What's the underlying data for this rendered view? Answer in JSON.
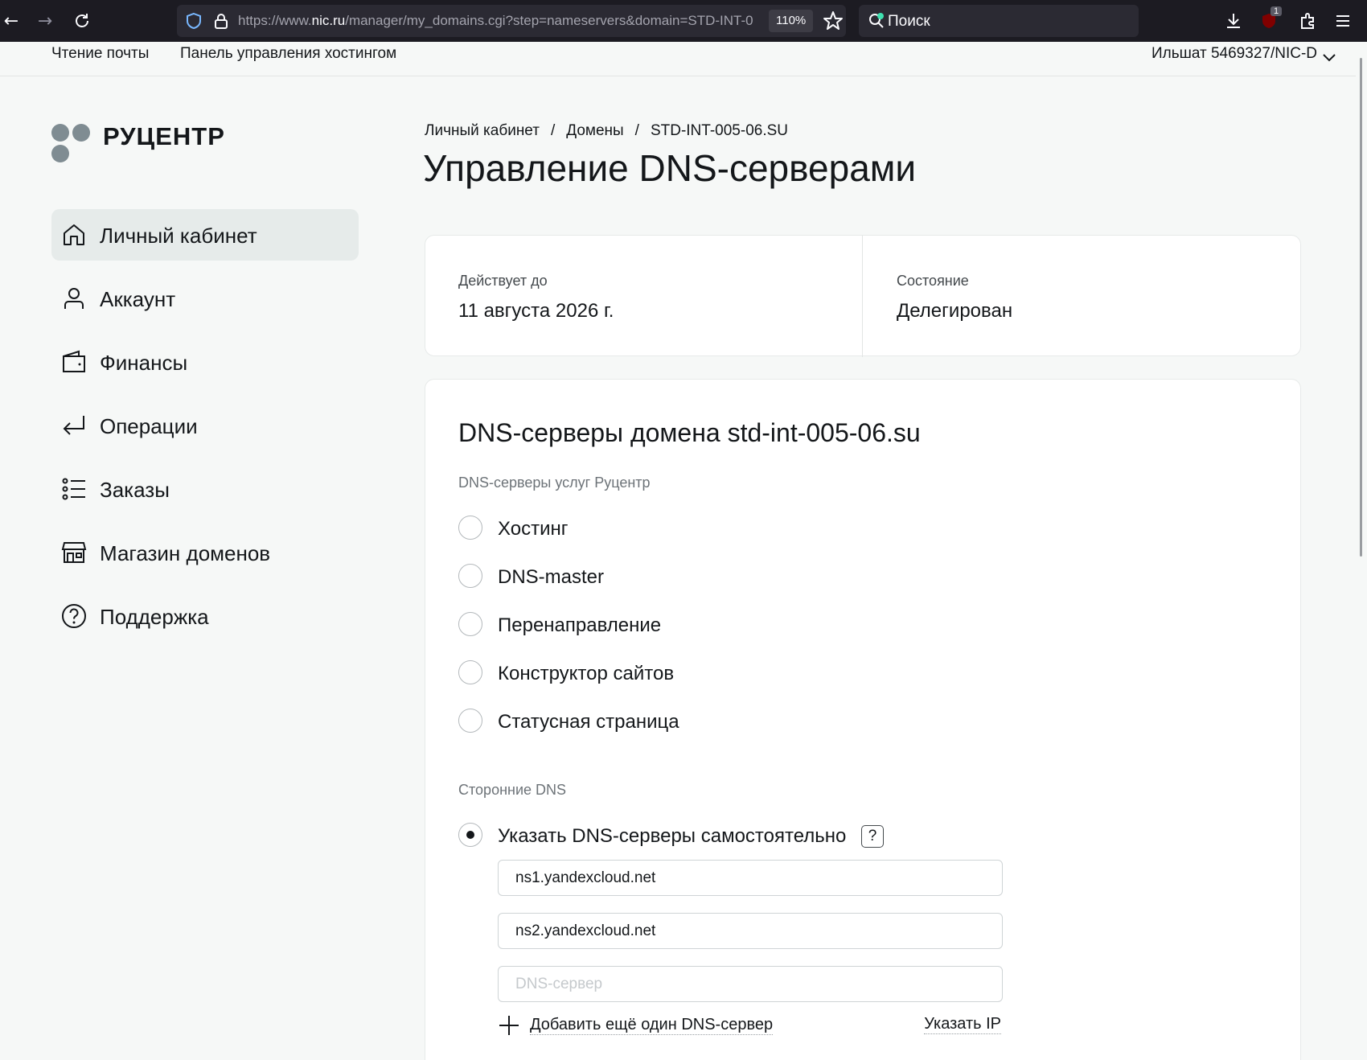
{
  "browser": {
    "url_prefix": "https://www.",
    "url_host": "nic.ru",
    "url_path": "/manager/my_domains.cgi?step=nameservers&domain=STD-INT-0",
    "zoom": "110%",
    "search_placeholder": "Поиск",
    "extension_badge": "1"
  },
  "topnav": {
    "mail": "Чтение почты",
    "hosting_panel": "Панель управления хостингом",
    "user": "Ильшат  5469327/NIC-D"
  },
  "logo": {
    "text": "РУЦЕНТР"
  },
  "sidebar": {
    "items": [
      {
        "label": "Личный кабинет",
        "icon": "home-icon"
      },
      {
        "label": "Аккаунт",
        "icon": "user-icon"
      },
      {
        "label": "Финансы",
        "icon": "wallet-icon"
      },
      {
        "label": "Операции",
        "icon": "return-arrow-icon"
      },
      {
        "label": "Заказы",
        "icon": "list-icon"
      },
      {
        "label": "Магазин доменов",
        "icon": "shop-icon"
      },
      {
        "label": "Поддержка",
        "icon": "help-circle-icon"
      }
    ]
  },
  "breadcrumb": {
    "items": [
      "Личный кабинет",
      "Домены",
      "STD-INT-005-06.SU"
    ]
  },
  "page": {
    "title": "Управление DNS-серверами"
  },
  "info": {
    "valid_until_label": "Действует до",
    "valid_until_value": "11 августа 2026 г.",
    "status_label": "Состояние",
    "status_value": "Делегирован"
  },
  "dns": {
    "title": "DNS-серверы домена std-int-005-06.su",
    "ru_section": "DNS-серверы услуг Руцентр",
    "options": [
      "Хостинг",
      "DNS-master",
      "Перенаправление",
      "Конструктор сайтов",
      "Статусная страница"
    ],
    "third_party_section": "Сторонние DNS",
    "custom_option": "Указать DNS-серверы самостоятельно",
    "help": "?",
    "server1": "ns1.yandexcloud.net",
    "server2": "ns2.yandexcloud.net",
    "server_placeholder": "DNS-сервер",
    "add_label": "Добавить ещё один DNS-сервер",
    "ip_label": "Указать IP"
  }
}
